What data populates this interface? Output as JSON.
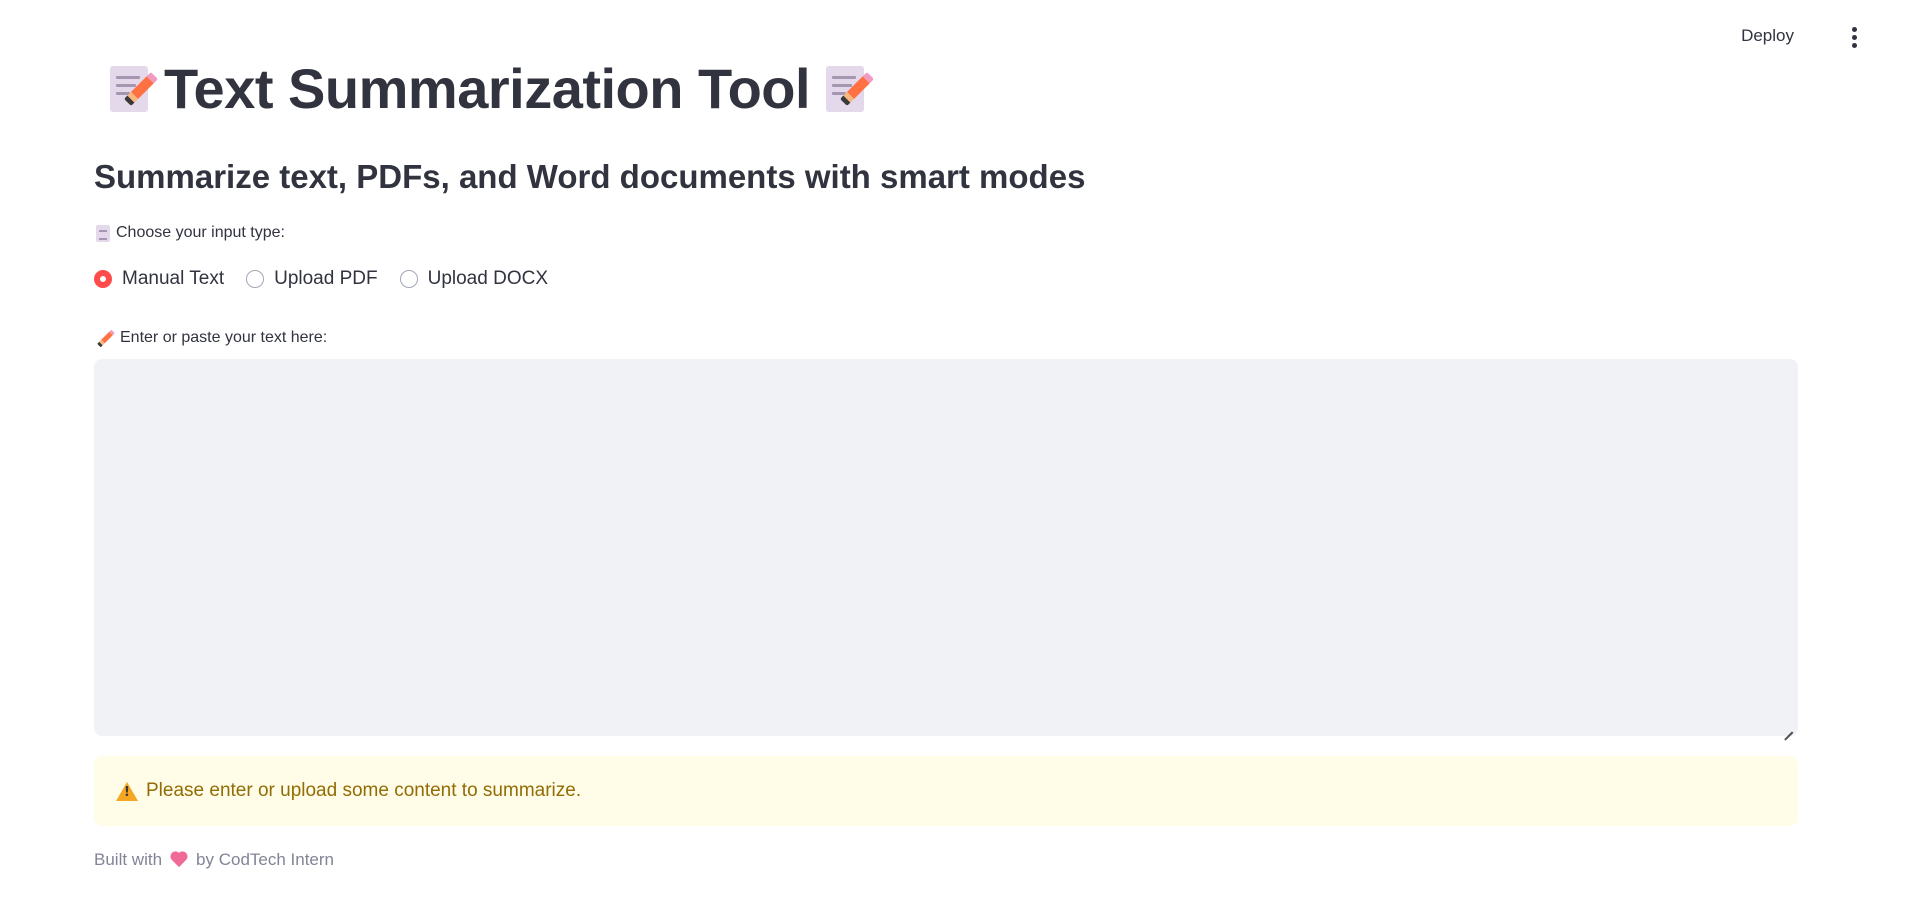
{
  "header": {
    "deploy_label": "Deploy",
    "menu_icon": "kebab-menu-icon"
  },
  "main": {
    "title": "Text Summarization Tool",
    "title_icon": "memo-icon",
    "subtitle": "Summarize text, PDFs, and Word documents with smart modes",
    "input_type": {
      "label": "Choose your input type:",
      "icon": "document-icon",
      "options": [
        {
          "label": "Manual Text",
          "selected": true
        },
        {
          "label": "Upload PDF",
          "selected": false
        },
        {
          "label": "Upload DOCX",
          "selected": false
        }
      ]
    },
    "text_input": {
      "label": "Enter or paste your text here:",
      "icon": "pencil-icon",
      "value": ""
    },
    "warning": {
      "icon": "warning-icon",
      "message": "Please enter or upload some content to summarize."
    },
    "footer": {
      "prefix": "Built with",
      "icon": "heart-icon",
      "suffix": "by CodTech Intern"
    }
  },
  "colors": {
    "accent": "#ff4b4b",
    "text": "#31333f",
    "textarea_bg": "#f0f2f6",
    "warning_bg": "#fffce7",
    "warning_text": "#926c05",
    "footer_text": "#808495"
  }
}
